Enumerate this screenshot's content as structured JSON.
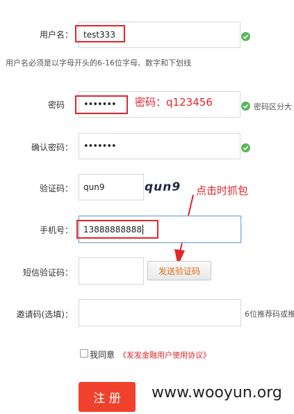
{
  "form": {
    "username": {
      "label": "用户名：",
      "value": "test333",
      "hint": "用户名必须是以字母开头的6-16位字母、数字和下划线"
    },
    "password": {
      "label": "密码",
      "value": "•••••••",
      "annotation": "密码：q123456",
      "hint": "密码区分大"
    },
    "confirm_password": {
      "label": "确认密码：",
      "value": "•••••••"
    },
    "captcha": {
      "label": "验证码：",
      "value": "qun9",
      "image_text": "qun9",
      "annotation": "点击时抓包"
    },
    "phone": {
      "label": "手机号：",
      "value": "13888888888"
    },
    "sms_code": {
      "label": "短信验证码：",
      "value": "",
      "send_button": "发送验证码"
    },
    "invite_code": {
      "label": "邀请码(选填)：",
      "value": "",
      "hint": "6位推荐码或推"
    },
    "agreement": {
      "text": "我同意",
      "link": "《发发金融用户使用协议》",
      "checked": false
    },
    "submit": "注 册"
  },
  "watermark": "www.wooyun.org",
  "colors": {
    "annotation_red": "#e0262b",
    "valid_green": "#5bb75b",
    "submit_red": "#f0412c"
  }
}
